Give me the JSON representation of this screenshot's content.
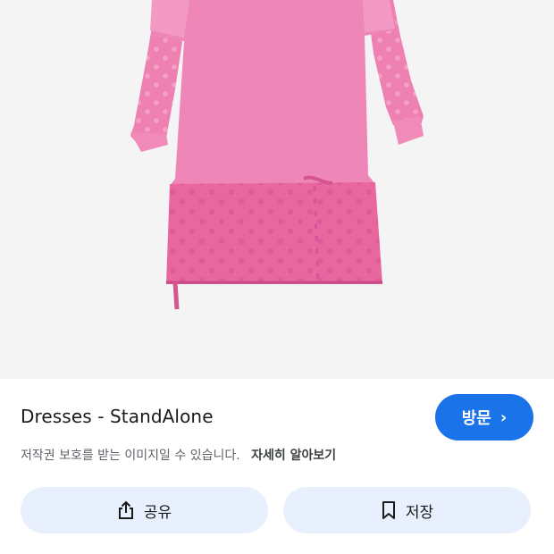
{
  "image": {
    "alt_icon": "pink-dress-photo",
    "colors": {
      "background": "#f4f4f4",
      "dress_top": "#ee86b8",
      "dress_skirt": "#e9679f"
    }
  },
  "info": {
    "title": "Dresses - StandAlone",
    "visit_label": "방문",
    "visit_chevron": "›",
    "copyright_text": "저작권 보호를 받는 이미지일 수 있습니다.",
    "learn_more_label": "자세히 알아보기",
    "share_label": "공유",
    "save_label": "저장",
    "accent_color": "#1a73e8"
  }
}
